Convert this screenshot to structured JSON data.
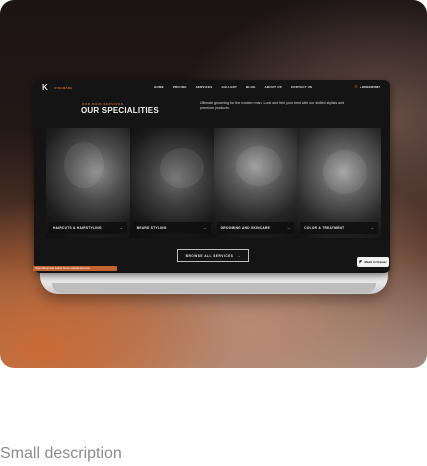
{
  "site": {
    "logo_mark": "K",
    "logo_text": "KINGMADE",
    "nav": [
      "HOME",
      "PRICING",
      "SERVICES",
      "GALLERY",
      "BLOG",
      "ABOUT US",
      "CONTACT US"
    ],
    "phone_icon": "phone-icon",
    "phone": "+18002345687"
  },
  "section": {
    "eyebrow": "OUR MAIN SERVICES",
    "title": "OUR SPECIALITIES",
    "intro": "Ultimate grooming for the modern man. Look and feel your best with our skilled stylists and premium products."
  },
  "services": [
    {
      "label": "HAIRCUTS & HAIRSTYLING",
      "arrow": "→"
    },
    {
      "label": "BEARD STYLING",
      "arrow": "→"
    },
    {
      "label": "GROOMING AND SKINCARE",
      "arrow": "→"
    },
    {
      "label": "COLOR & TREATMENT",
      "arrow": "→"
    }
  ],
  "cta": {
    "label": "BROWSE ALL SERVICES",
    "arrow": "→"
  },
  "badge": {
    "label": "Made in Framer"
  },
  "url": "https://kingmade-barber.framer.website/services",
  "caption": "Small description",
  "colors": {
    "accent": "#c8683a",
    "screen_bg": "#141414"
  }
}
